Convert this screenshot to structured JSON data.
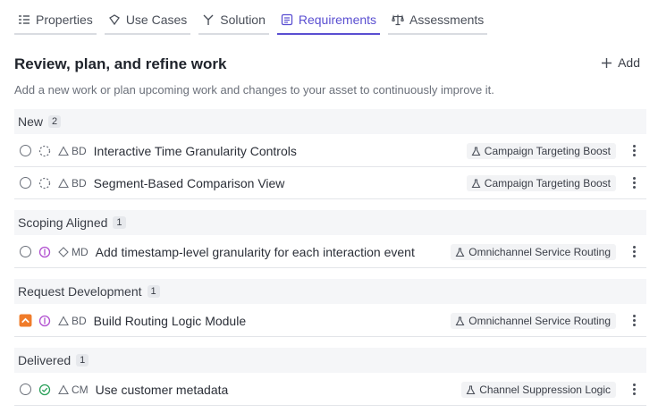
{
  "tabs": [
    {
      "label": "Properties",
      "icon": "properties-icon"
    },
    {
      "label": "Use Cases",
      "icon": "tag-icon"
    },
    {
      "label": "Solution",
      "icon": "branch-icon"
    },
    {
      "label": "Requirements",
      "icon": "list-icon",
      "active": true
    },
    {
      "label": "Assessments",
      "icon": "scale-icon"
    }
  ],
  "header": {
    "title": "Review, plan, and refine work",
    "add_label": "Add",
    "subtitle": "Add a new work or plan upcoming work and changes to your asset to continuously improve it."
  },
  "groups": [
    {
      "label": "New",
      "count": "2",
      "items": [
        {
          "code": "BD",
          "name": "Interactive Time Granularity Controls",
          "tag": "Campaign Targeting Boost"
        },
        {
          "code": "BD",
          "name": "Segment-Based Comparison View",
          "tag": "Campaign Targeting Boost"
        }
      ]
    },
    {
      "label": "Scoping Aligned",
      "count": "1",
      "items": [
        {
          "code": "MD",
          "name": "Add timestamp-level granularity for each interaction event",
          "tag": "Omnichannel Service Routing"
        }
      ]
    },
    {
      "label": "Request Development",
      "count": "1",
      "items": [
        {
          "code": "BD",
          "name": "Build Routing Logic Module",
          "tag": "Omnichannel Service Routing"
        }
      ]
    },
    {
      "label": "Delivered",
      "count": "1",
      "items": [
        {
          "code": "CM",
          "name": "Use customer metadata",
          "tag": "Channel Suppression Logic"
        }
      ]
    }
  ],
  "colors": {
    "accent": "#5a4fd1",
    "priority_high": "#f07c2a",
    "in_progress": "#b04fcf",
    "done": "#2aa05a"
  }
}
